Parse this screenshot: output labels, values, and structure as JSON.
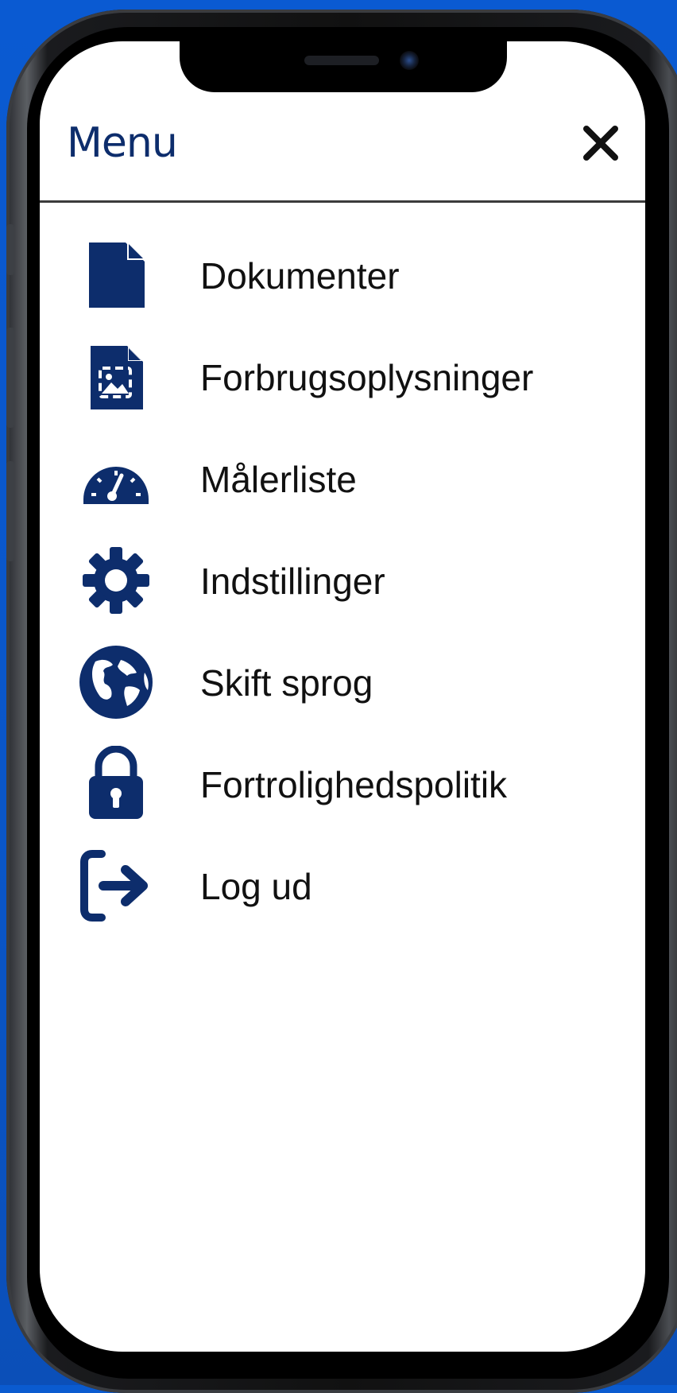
{
  "header": {
    "title": "Menu",
    "close_icon": "close-icon"
  },
  "menu": {
    "items": [
      {
        "label": "Dokumenter",
        "icon": "document-icon"
      },
      {
        "label": "Forbrugsoplysninger",
        "icon": "consumption-report-icon"
      },
      {
        "label": "Målerliste",
        "icon": "meter-gauge-icon"
      },
      {
        "label": "Indstillinger",
        "icon": "gear-icon"
      },
      {
        "label": "Skift sprog",
        "icon": "globe-icon"
      },
      {
        "label": "Fortrolighedspolitik",
        "icon": "lock-icon"
      },
      {
        "label": "Log ud",
        "icon": "logout-icon"
      }
    ]
  },
  "colors": {
    "accent": "#0d2d6c",
    "background": "#0a5ad2",
    "text": "#111111"
  }
}
